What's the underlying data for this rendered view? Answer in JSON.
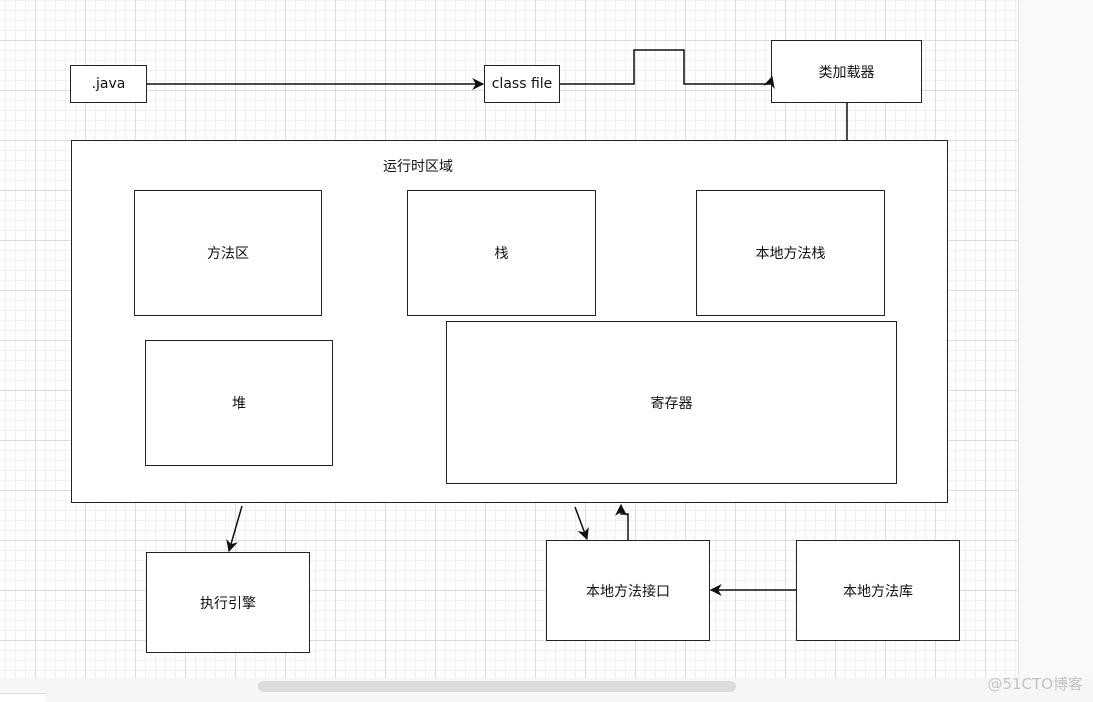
{
  "diagram": {
    "nodes": {
      "java": ".java",
      "class_file": "class file",
      "class_loader": "类加载器",
      "runtime_area": "运行时区域",
      "method_area": "方法区",
      "stack": "栈",
      "native_stack": "本地方法栈",
      "heap": "堆",
      "register": "寄存器",
      "exec_engine": "执行引擎",
      "native_interface": "本地方法接口",
      "native_library": "本地方法库"
    },
    "edges": [
      {
        "from": ".java",
        "to": "class file"
      },
      {
        "from": "class file",
        "to": "类加载器"
      },
      {
        "from": "类加载器",
        "to": "运行时区域"
      },
      {
        "from": "运行时区域",
        "to": "执行引擎"
      },
      {
        "from": "运行时区域",
        "to": "本地方法接口"
      },
      {
        "from": "本地方法接口",
        "to": "运行时区域"
      },
      {
        "from": "本地方法库",
        "to": "本地方法接口"
      }
    ]
  },
  "watermark": "@51CTO博客",
  "colors": {
    "stroke": "#222222",
    "grid": "#dcdcdc",
    "canvas": "#ffffff"
  }
}
